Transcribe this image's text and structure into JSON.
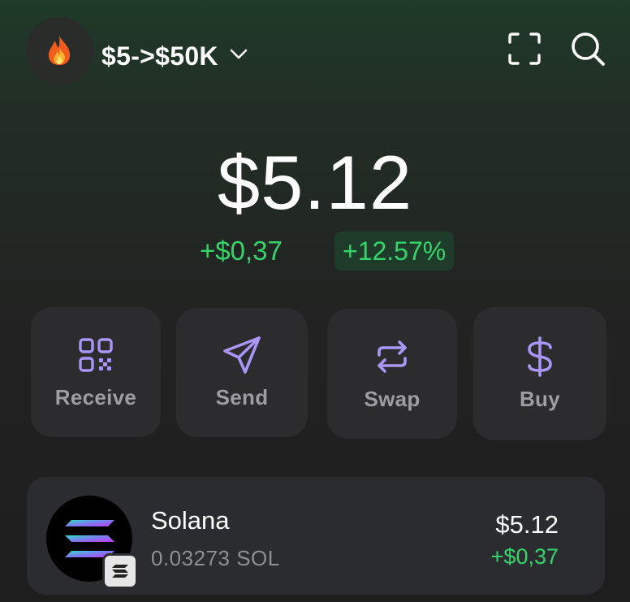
{
  "header": {
    "account_icon": "fire-emoji-icon",
    "account_name": "$5->$50K",
    "dropdown_icon": "chevron-down-icon",
    "scan_icon": "scan-frame-icon",
    "search_icon": "search-icon"
  },
  "portfolio": {
    "balance": "$5.12",
    "change_abs": "+$0,37",
    "change_pct": "+12.57%"
  },
  "actions": [
    {
      "label": "Receive",
      "icon": "qr-code-icon"
    },
    {
      "label": "Send",
      "icon": "paper-plane-icon"
    },
    {
      "label": "Swap",
      "icon": "swap-arrows-icon"
    },
    {
      "label": "Buy",
      "icon": "dollar-sign-icon"
    }
  ],
  "tokens": [
    {
      "name": "Solana",
      "amount": "0.03273 SOL",
      "value": "$5.12",
      "change": "+$0,37",
      "icon": "solana-logo-icon",
      "network_badge": "solana-network-badge-icon"
    }
  ],
  "colors": {
    "accent_purple": "#a996f7",
    "positive_green": "#34d66b",
    "card_bg": "#2c2c2e",
    "pill_bg": "#1f3b2a"
  }
}
